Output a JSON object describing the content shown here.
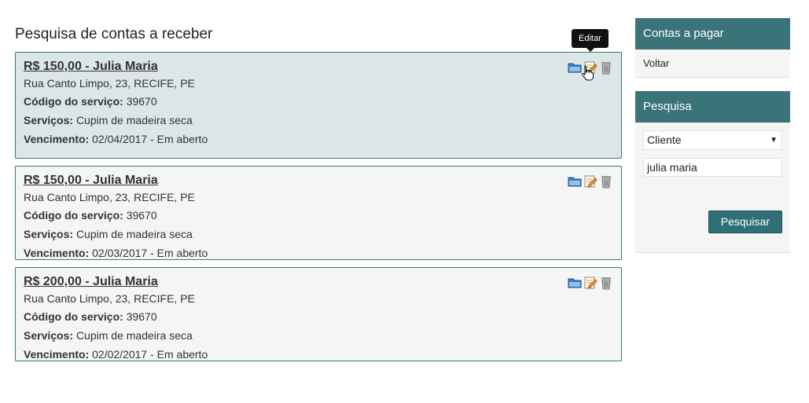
{
  "page": {
    "title": "Pesquisa de contas a receber"
  },
  "tooltip": {
    "text": "Editar"
  },
  "labels": {
    "codigo": "Código do serviço:",
    "servicos": "Serviços:",
    "vencimento": "Vencimento:"
  },
  "cards": [
    {
      "title": "R$ 150,00 - Julia Maria",
      "address": "Rua Canto Limpo, 23, RECIFE, PE",
      "codigo": "39670",
      "servicos": "Cupim de madeira seca",
      "vencimento": "02/04/2017 - Em aberto"
    },
    {
      "title": "R$ 150,00 - Julia Maria",
      "address": "Rua Canto Limpo, 23, RECIFE, PE",
      "codigo": "39670",
      "servicos": "Cupim de madeira seca",
      "vencimento": "02/03/2017 - Em aberto"
    },
    {
      "title": "R$ 200,00 - Julia Maria",
      "address": "Rua Canto Limpo, 23, RECIFE, PE",
      "codigo": "39670",
      "servicos": "Cupim de madeira seca",
      "vencimento": "02/02/2017 - Em aberto"
    }
  ],
  "sidebar": {
    "contas_panel": {
      "title": "Contas a pagar",
      "link": "Voltar"
    },
    "search_panel": {
      "title": "Pesquisa",
      "select_value": "Cliente",
      "input_value": "julia maria",
      "button_label": "Pesquisar"
    }
  },
  "colors": {
    "accent": "#3a7378",
    "active_card_bg": "#dde6e7",
    "card_bg": "#f5f5f5"
  },
  "icons": [
    "folder-icon",
    "edit-icon",
    "trash-icon"
  ]
}
